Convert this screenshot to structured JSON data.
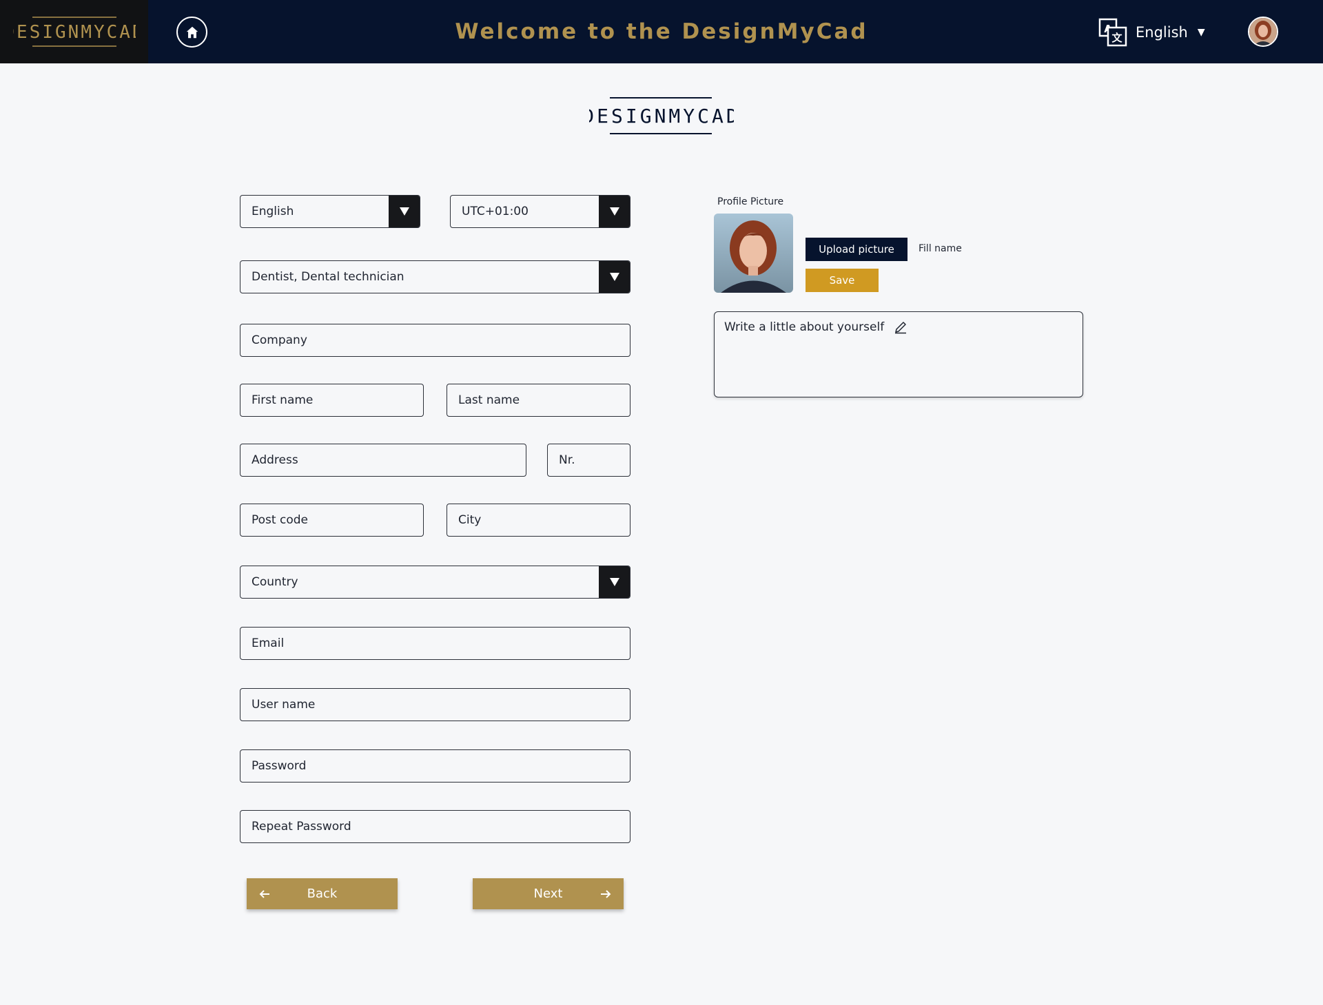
{
  "header": {
    "title": "Welcome to the DesignMyCad",
    "language_label": "English",
    "logo_text": "DESIGNMYCAD"
  },
  "brand": {
    "logo_text": "DESIGNMYCAD"
  },
  "form": {
    "language_value": "English",
    "timezone_value": "UTC+01:00",
    "profession_value": "Dentist, Dental technician",
    "company_placeholder": "Company",
    "first_name_placeholder": "First name",
    "last_name_placeholder": "Last name",
    "address_placeholder": "Address",
    "nr_placeholder": "Nr.",
    "post_code_placeholder": "Post code",
    "city_placeholder": "City",
    "country_placeholder": "Country",
    "email_placeholder": "Email",
    "username_placeholder": "User name",
    "password_placeholder": "Password",
    "repeat_password_placeholder": "Repeat Password"
  },
  "profile": {
    "label": "Profile Picture",
    "upload_label": "Upload picture",
    "fill_name": "Fill name",
    "save_label": "Save",
    "about_placeholder": "Write a little about yourself"
  },
  "nav": {
    "back_label": "Back",
    "next_label": "Next"
  },
  "icons": {
    "home": "home-icon",
    "translate": "translate-icon",
    "dropdown": "caret-down-icon",
    "pencil": "pencil-icon",
    "arrow_left": "arrow-left-icon",
    "arrow_right": "arrow-right-icon"
  },
  "colors": {
    "header_bg": "#06132d",
    "gold": "#b0924f",
    "save": "#d09a22",
    "page_bg": "#f6f7f9"
  }
}
